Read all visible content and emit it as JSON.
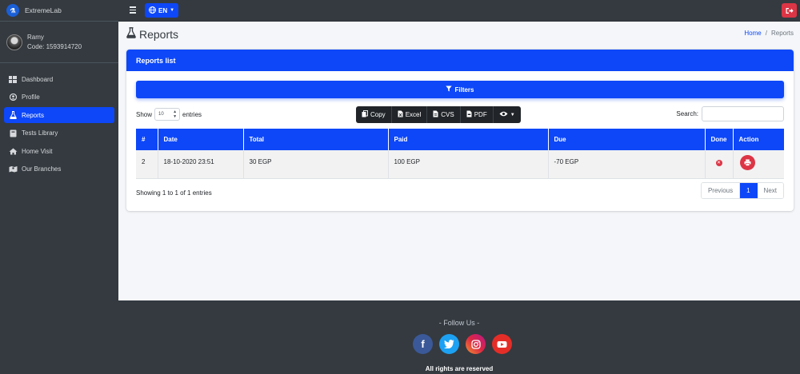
{
  "brand": {
    "name": "ExtremeLab"
  },
  "user": {
    "name": "Ramy",
    "code": "Code: 1593914720"
  },
  "sidebar": {
    "items": [
      {
        "label": "Dashboard",
        "icon": "dashboard-icon",
        "active": false
      },
      {
        "label": "Profile",
        "icon": "user-icon",
        "active": false
      },
      {
        "label": "Reports",
        "icon": "flask-icon",
        "active": true
      },
      {
        "label": "Tests Library",
        "icon": "book-icon",
        "active": false
      },
      {
        "label": "Home Visit",
        "icon": "home-icon",
        "active": false
      },
      {
        "label": "Our Branches",
        "icon": "map-icon",
        "active": false
      }
    ]
  },
  "topbar": {
    "language": "EN"
  },
  "page": {
    "title": "Reports",
    "breadcrumb": {
      "home": "Home",
      "current": "Reports"
    }
  },
  "card": {
    "title": "Reports list",
    "filters_label": "Filters",
    "show_label": "Show",
    "entries_value": "10",
    "entries_label": "entries",
    "search_label": "Search:",
    "search_value": "",
    "export_buttons": [
      "Copy",
      "Excel",
      "CVS",
      "PDF"
    ],
    "table": {
      "headers": [
        "#",
        "Date",
        "Total",
        "Paid",
        "Due",
        "Done",
        "Action"
      ],
      "rows": [
        {
          "num": "2",
          "date": "18-10-2020 23:51",
          "total": "30 EGP",
          "paid": "100 EGP",
          "due": "-70 EGP",
          "done": false
        }
      ]
    },
    "info": "Showing 1 to 1 of 1 entries",
    "pagination": {
      "previous": "Previous",
      "current": "1",
      "next": "Next"
    }
  },
  "footer": {
    "follow": "- Follow Us -",
    "copyright": "All rights are reserved",
    "socials": [
      "facebook-icon",
      "twitter-icon",
      "instagram-icon",
      "youtube-icon"
    ]
  },
  "colors": {
    "primary": "#0d47f8",
    "sidebar": "#343a40",
    "danger": "#dc3545",
    "background": "#f4f6f9"
  }
}
